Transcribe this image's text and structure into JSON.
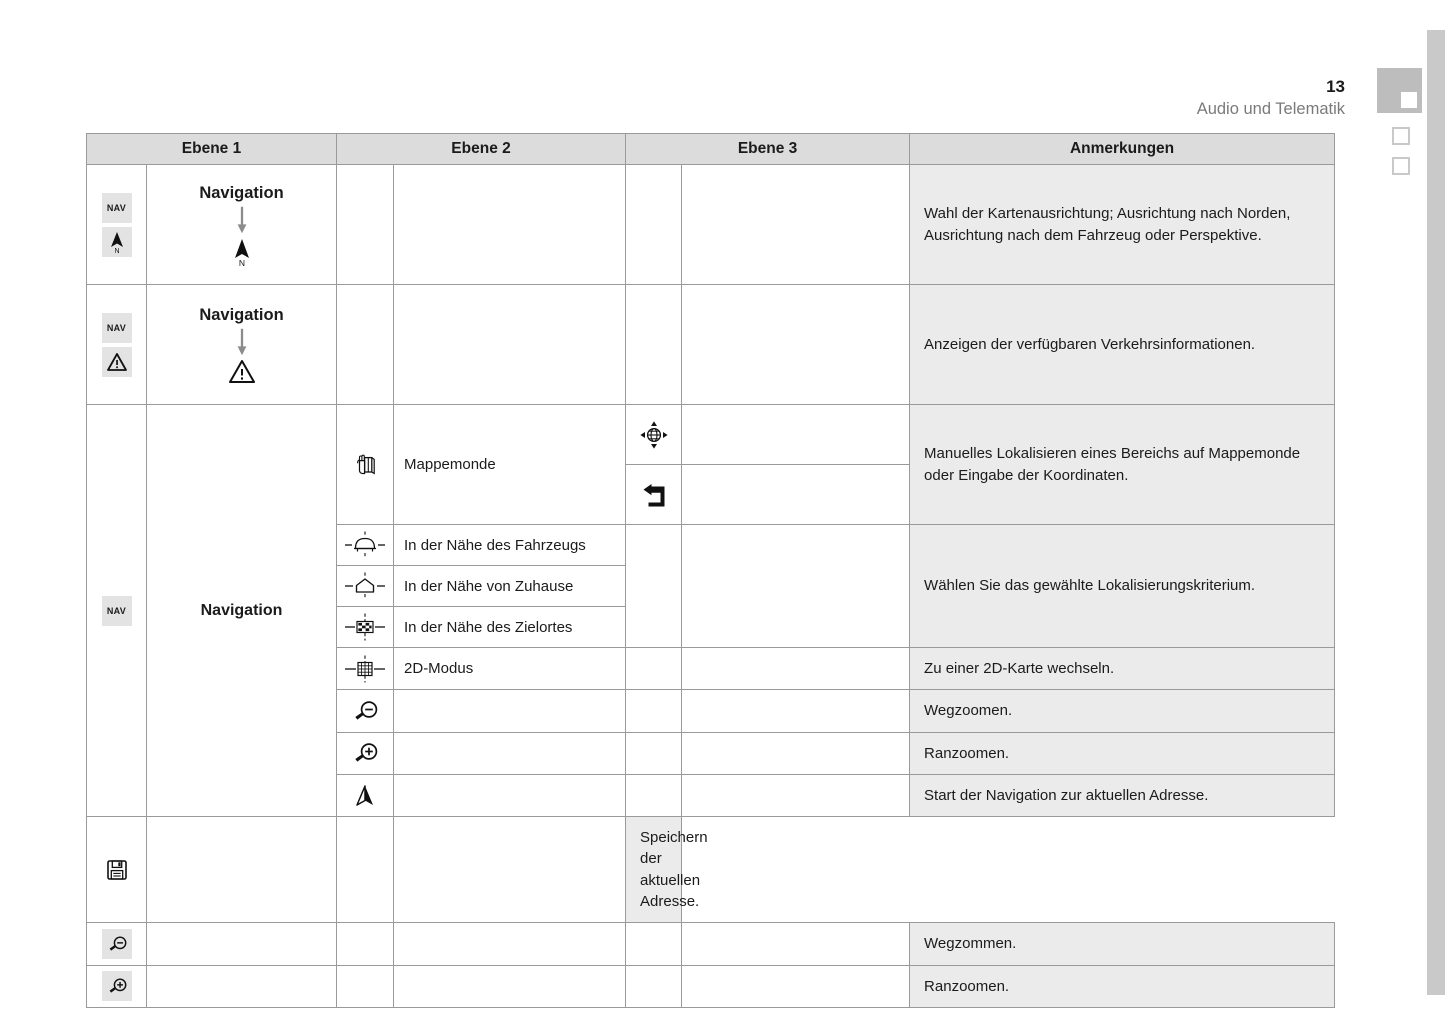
{
  "header": {
    "page_number": "13",
    "section": "Audio und Telematik"
  },
  "table": {
    "columns": [
      "Ebene 1",
      "Ebene 2",
      "Ebene 3",
      "Anmerkungen"
    ],
    "rows": [
      {
        "id": "row-map-orientation",
        "level1_icons": [
          "nav-tile",
          "north-arrow-tile"
        ],
        "level1_label": "Navigation",
        "level1_path_icon": "north-arrow-icon",
        "remark": "Wahl der Kartenausrichtung; Ausrichtung nach Norden, Ausrichtung nach dem Fahrzeug oder Perspektive."
      },
      {
        "id": "row-traffic-info",
        "level1_icons": [
          "nav-tile",
          "warning-triangle-tile"
        ],
        "level1_label": "Navigation",
        "level1_path_icon": "warning-triangle-icon",
        "remark": "Anzeigen der verfügbaren Verkehrsinformationen."
      },
      {
        "id": "row-mappemonde",
        "level1_icons": [
          "nav-tile"
        ],
        "level1_label": "Navigation",
        "level2_icon": "hand-map-icon",
        "level2_label": "Mappemonde",
        "level3_icons": [
          "globe-move-icon",
          "return-arrow-icon"
        ],
        "remark": "Manuelles Lokalisieren eines Bereichs auf Mappemonde oder Eingabe der Koordinaten."
      },
      {
        "id": "row-near-vehicle",
        "level2_icon": "car-near-icon",
        "level2_label": "In der Nähe des Fahrzeugs",
        "remark": "Wählen Sie das gewählte Lokalisierungskriterium."
      },
      {
        "id": "row-near-home",
        "level2_icon": "home-near-icon",
        "level2_label": "In der Nähe von Zuhause"
      },
      {
        "id": "row-near-destination",
        "level2_icon": "flag-near-icon",
        "level2_label": "In der Nähe des Zielortes"
      },
      {
        "id": "row-2d-mode",
        "level2_icon": "grid-2d-icon",
        "level2_label": "2D-Modus",
        "remark": "Zu einer 2D-Karte wechseln."
      },
      {
        "id": "row-zoom-out-1",
        "level2_icon": "zoom-out-icon",
        "level2_label": "",
        "remark": "Wegzoomen."
      },
      {
        "id": "row-zoom-in-1",
        "level2_icon": "zoom-in-icon",
        "level2_label": "",
        "remark": "Ranzoomen."
      },
      {
        "id": "row-start-navigation",
        "level2_icon": "nav-arrow-icon",
        "level2_label": "",
        "remark": "Start der Navigation zur aktuellen Adresse."
      },
      {
        "id": "row-save-address",
        "level2_icon": "floppy-save-icon",
        "level2_label": "",
        "remark": "Speichern der aktuellen Adresse."
      },
      {
        "id": "row-zoom-out-2",
        "level1_icons": [
          "zoom-out-tile"
        ],
        "remark": "Wegzommen."
      },
      {
        "id": "row-zoom-in-2",
        "level1_icons": [
          "zoom-in-tile"
        ],
        "remark": "Ranzoomen."
      }
    ]
  },
  "colors": {
    "header_fill": "#dcdcdc",
    "remark_fill": "#ebebeb",
    "tile_fill": "#e3e3e3",
    "border": "#9a9a9a",
    "section_text": "#7a7a7a",
    "sidebar": "#c9c9c9"
  }
}
